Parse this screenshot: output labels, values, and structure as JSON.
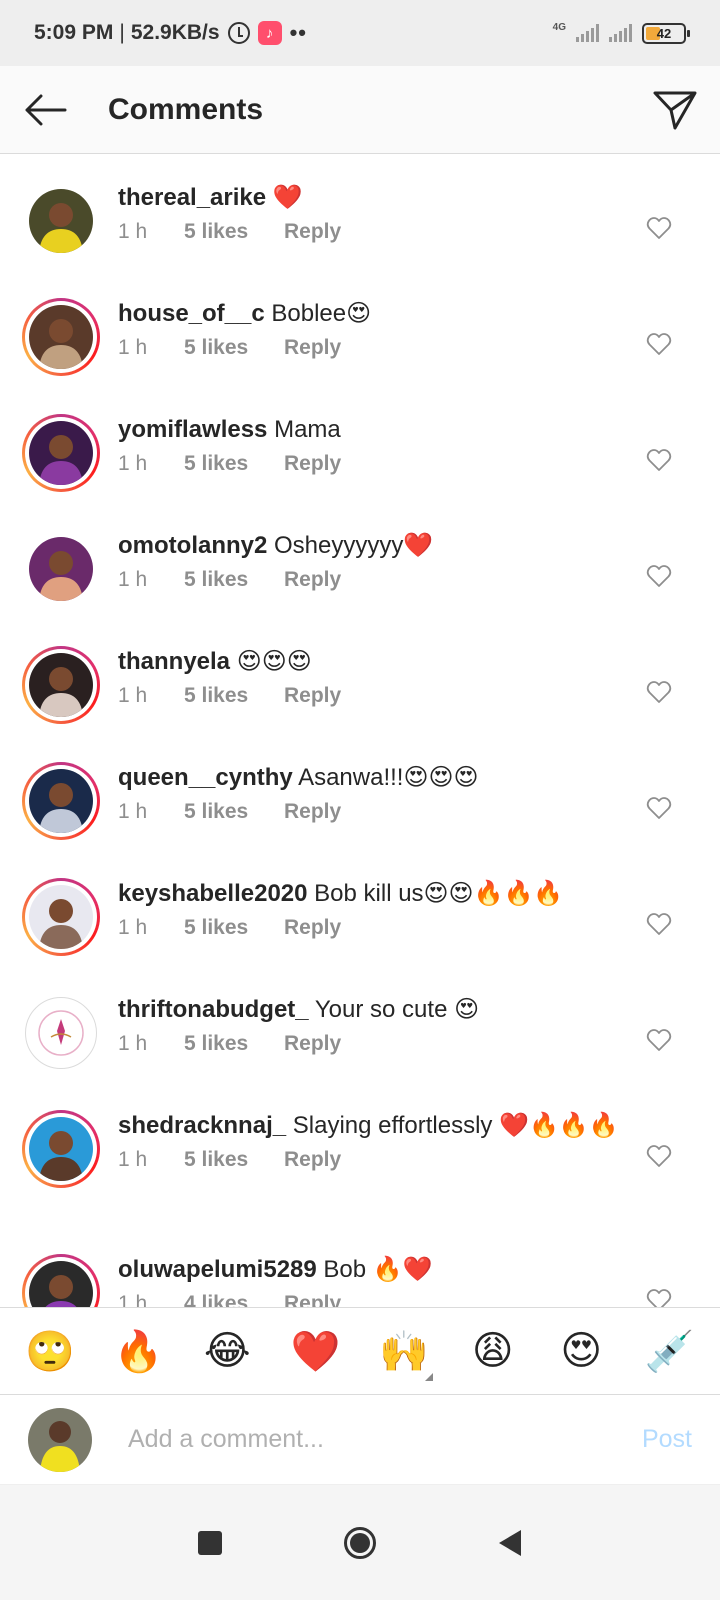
{
  "status_bar": {
    "time": "5:09 PM",
    "separator": "|",
    "speed": "52.9KB/s",
    "dots": "••",
    "network_type": "4G",
    "battery_level": "42",
    "icons": [
      "alarm-icon",
      "tiktok-icon",
      "signal-icon",
      "battery-icon"
    ]
  },
  "header": {
    "title": "Comments",
    "back_icon": "arrow-left-icon",
    "share_icon": "paper-plane-icon"
  },
  "comments": [
    {
      "user": "thereal_arike",
      "text": " ❤️",
      "time": "1 h",
      "likes": "5 likes",
      "reply": "Reply",
      "story_ring": false,
      "avatar_colors": [
        "#4a4a2a",
        "#e8d020"
      ]
    },
    {
      "user": "house_of__c",
      "text": " Boblee😍",
      "time": "1 h",
      "likes": "5 likes",
      "reply": "Reply",
      "story_ring": true,
      "avatar_colors": [
        "#5a3a2a",
        "#c0a080"
      ]
    },
    {
      "user": "yomiflawless",
      "text": " Mama",
      "time": "1 h",
      "likes": "5 likes",
      "reply": "Reply",
      "story_ring": true,
      "avatar_colors": [
        "#3a1a4a",
        "#8a3aa0"
      ]
    },
    {
      "user": "omotolanny2",
      "text": " Osheyyyyyy❤️",
      "time": "1 h",
      "likes": "5 likes",
      "reply": "Reply",
      "story_ring": false,
      "avatar_colors": [
        "#6a2a6a",
        "#e0a080"
      ]
    },
    {
      "user": "thannyela",
      "text": " 😍😍😍",
      "time": "1 h",
      "likes": "5 likes",
      "reply": "Reply",
      "story_ring": true,
      "avatar_colors": [
        "#2a2020",
        "#d8c8c0"
      ]
    },
    {
      "user": "queen__cynthy",
      "text": " Asanwa!!!😍😍😍",
      "time": "1 h",
      "likes": "5 likes",
      "reply": "Reply",
      "story_ring": true,
      "avatar_colors": [
        "#1a2a4a",
        "#c0c8d8"
      ]
    },
    {
      "user": "keyshabelle2020",
      "text": " Bob kill us😍😍🔥🔥🔥",
      "time": "1 h",
      "likes": "5 likes",
      "reply": "Reply",
      "story_ring": true,
      "avatar_colors": [
        "#e8e8f0",
        "#8a6a5a"
      ]
    },
    {
      "user": "thriftonabudget_",
      "text": " Your so cute 😍",
      "time": "1 h",
      "likes": "5 likes",
      "reply": "Reply",
      "story_ring": false,
      "logo": true,
      "avatar_colors": [
        "#ffffff",
        "#c43a7a"
      ]
    },
    {
      "user": "shedracknnaj_",
      "text": " Slaying effortlessly ❤️🔥🔥🔥",
      "time": "1 h",
      "likes": "5 likes",
      "reply": "Reply",
      "story_ring": true,
      "avatar_colors": [
        "#2a9ad8",
        "#5a3a2a"
      ]
    },
    {
      "user": "oluwapelumi5289",
      "text": " Bob 🔥❤️",
      "time": "1 h",
      "likes": "4 likes",
      "reply": "Reply",
      "story_ring": true,
      "avatar_colors": [
        "#2a2a2a",
        "#8a3ab0"
      ]
    }
  ],
  "emoji_bar": [
    "🙄",
    "🔥",
    "😂",
    "❤️",
    "🙌",
    "😩",
    "😍",
    "💉"
  ],
  "comment_input": {
    "placeholder": "Add a comment...",
    "value": "",
    "post_label": "Post"
  },
  "nav_bar": {
    "icons": [
      "recent-apps-icon",
      "home-icon",
      "back-icon"
    ]
  }
}
